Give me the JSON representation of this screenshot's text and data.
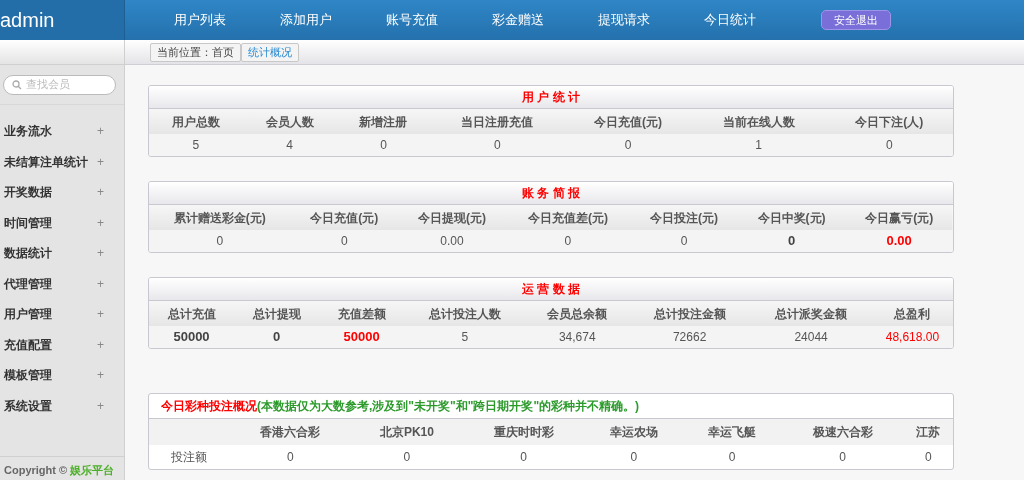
{
  "brand": "admin",
  "nav": [
    {
      "label": "用户列表"
    },
    {
      "label": "添加用户"
    },
    {
      "label": "账号充值"
    },
    {
      "label": "彩金赠送"
    },
    {
      "label": "提现请求"
    },
    {
      "label": "今日统计"
    }
  ],
  "logout": "安全退出",
  "breadcrumb": [
    {
      "label": "当前位置：首页",
      "selected": false
    },
    {
      "label": "统计概况",
      "selected": true
    }
  ],
  "search": {
    "placeholder": "查找会员"
  },
  "sidebar": {
    "items": [
      {
        "label": "业务流水",
        "toggle": "+"
      },
      {
        "label": "未结算注单统计",
        "toggle": "+"
      },
      {
        "label": "开奖数据",
        "toggle": "+"
      },
      {
        "label": "时间管理",
        "toggle": "+"
      },
      {
        "label": "数据统计",
        "toggle": "+"
      },
      {
        "label": "代理管理",
        "toggle": "+"
      },
      {
        "label": "用户管理",
        "toggle": "+"
      },
      {
        "label": "充值配置",
        "toggle": "+"
      },
      {
        "label": "模板管理",
        "toggle": "+"
      },
      {
        "label": "系统设置",
        "toggle": "+"
      }
    ]
  },
  "copyright": {
    "text": "Copyright ©",
    "brand": "娱乐平台"
  },
  "panels": [
    {
      "title": "用 户 统 计",
      "columns": [
        "用户总数",
        "会员人数",
        "新增注册",
        "当日注册充值",
        "今日充值(元)",
        "当前在线人数",
        "今日下注(人)"
      ],
      "row": [
        {
          "text": "5",
          "kind": "plain"
        },
        {
          "text": "4",
          "kind": "plain"
        },
        {
          "text": "0",
          "kind": "plain"
        },
        {
          "text": "0",
          "kind": "plain"
        },
        {
          "text": "0",
          "kind": "plain"
        },
        {
          "text": "1",
          "kind": "plain"
        },
        {
          "text": "0",
          "kind": "plain"
        }
      ]
    },
    {
      "title": "账 务 简 报",
      "columns": [
        "累计赠送彩金(元)",
        "今日充值(元)",
        "今日提现(元)",
        "今日充值差(元)",
        "今日投注(元)",
        "今日中奖(元)",
        "今日赢亏(元)"
      ],
      "row": [
        {
          "text": "0",
          "kind": "plain"
        },
        {
          "text": "0",
          "kind": "plain"
        },
        {
          "text": "0.00",
          "kind": "plain"
        },
        {
          "text": "0",
          "kind": "plain"
        },
        {
          "text": "0",
          "kind": "plain"
        },
        {
          "text": "0",
          "kind": "strong"
        },
        {
          "text": "0.00",
          "kind": "alert-strong"
        }
      ]
    },
    {
      "title": "运 营 数 据",
      "columns": [
        "总计充值",
        "总计提现",
        "充值差额",
        "总计投注人数",
        "会员总余额",
        "总计投注金额",
        "总计派奖金额",
        "总盈利"
      ],
      "row": [
        {
          "text": "50000",
          "kind": "strong"
        },
        {
          "text": "0",
          "kind": "strong"
        },
        {
          "text": "50000",
          "kind": "alert-strong"
        },
        {
          "text": "5",
          "kind": "plain"
        },
        {
          "text": "34,674",
          "kind": "plain"
        },
        {
          "text": "72662",
          "kind": "plain"
        },
        {
          "text": "24044",
          "kind": "plain"
        },
        {
          "text": "48,618.00",
          "kind": "alert"
        }
      ]
    }
  ],
  "lottery": {
    "title": "今日彩种投注概况",
    "note": "(本数据仅为大数参考,涉及到\"未开奖\"和\"跨日期开奖\"的彩种并不精确。)",
    "columns": [
      "香港六合彩",
      "北京PK10",
      "重庆时时彩",
      "幸运农场",
      "幸运飞艇",
      "极速六合彩",
      "江苏"
    ],
    "row_label": "投注额",
    "values": [
      "0",
      "0",
      "0",
      "0",
      "0",
      "0",
      "0"
    ]
  }
}
